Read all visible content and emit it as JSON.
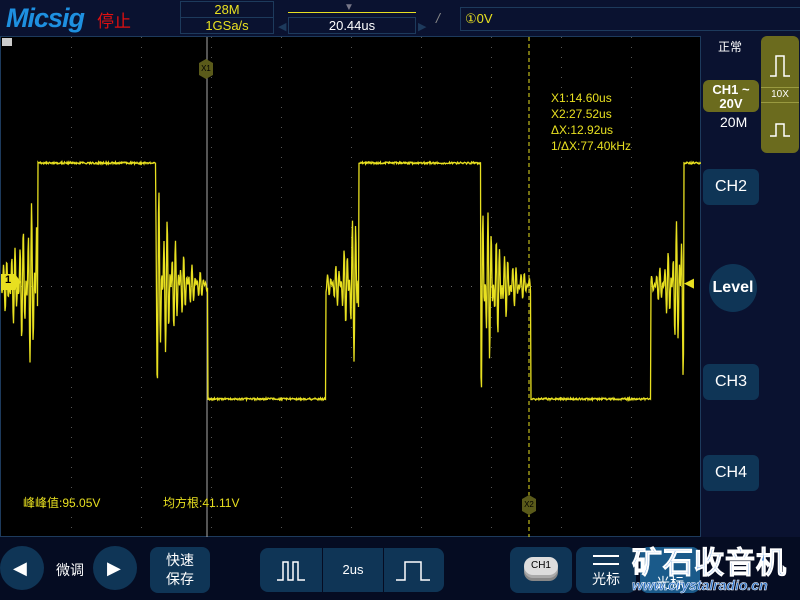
{
  "header": {
    "brand": "Micsig",
    "status": "停止",
    "memory_depth": "28M",
    "sample_rate": "1GSa/s",
    "trigger_position": "20.44us",
    "trigger_level": "①0V"
  },
  "channel_panel": {
    "trigger_mode": "正常",
    "ch1_label": "CH1 ~",
    "ch1_scale": "20V",
    "ch1_bandwidth": "20M",
    "probe": "10X",
    "ch2": "CH2",
    "ch3": "CH3",
    "ch4": "CH4",
    "level": "Level"
  },
  "cursors": {
    "x1_marker": "X1",
    "x2_marker": "X2",
    "x1": "X1:14.60us",
    "x2": "X2:27.52us",
    "dx": "ΔX:12.92us",
    "inv_dx": "1/ΔX:77.40kHz"
  },
  "measurements": {
    "peak_to_peak": "峰峰值:95.05V",
    "rms": "均方根:41.11V"
  },
  "ch1_marker": "1",
  "bottom": {
    "fine_adjust": "微调",
    "quick_save_1": "快速",
    "quick_save_2": "保存",
    "timebase": "2us",
    "ch1_button": "CH1",
    "cursor_button": "光标",
    "cursor_button_2": "光标"
  },
  "watermark": {
    "cn": "矿石收音机",
    "url": "www.crystalradio.cn"
  },
  "colors": {
    "trace": "#e8e020",
    "accent": "#6b6b1e",
    "button": "#0f3556"
  }
}
